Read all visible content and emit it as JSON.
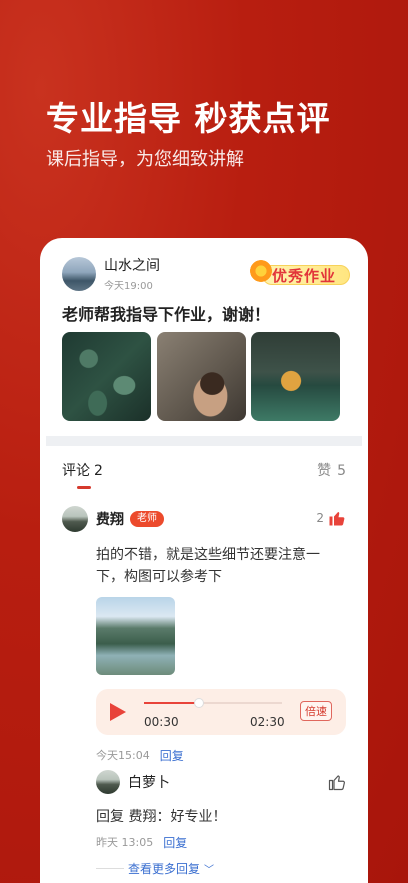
{
  "hero": {
    "title": "专业指导 秒获点评",
    "subtitle": "课后指导，为您细致讲解"
  },
  "post": {
    "user_name": "山水之间",
    "time": "今天19:00",
    "badge": "优秀作业",
    "text": "老师帮我指导下作业，谢谢！"
  },
  "tabs": {
    "comment_label": "评论",
    "comment_count": "2",
    "like_label": "赞",
    "like_count": "5"
  },
  "comment": {
    "user_name": "费翔",
    "role_badge": "老师",
    "likes": "2",
    "text": "拍的不错，就是这些细节还要注意一下，构图可以参考下",
    "audio": {
      "current": "00:30",
      "total": "02:30",
      "progress": 0.4,
      "speed_label": "倍速"
    },
    "time": "今天15:04",
    "reply_label": "回复"
  },
  "reply": {
    "user_name": "白萝卜",
    "text": "回复 费翔：好专业！",
    "time": "昨天 13:05",
    "reply_label": "回复"
  },
  "more_replies": "查看更多回复",
  "colors": {
    "brand_red": "#b81e10",
    "accent": "#e8433a",
    "link": "#3b6fd0"
  }
}
